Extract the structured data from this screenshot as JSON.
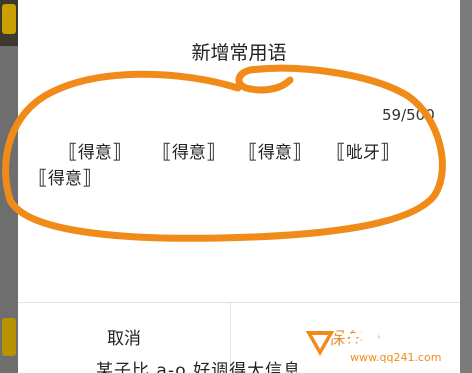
{
  "dialog": {
    "title": "新增常用语",
    "counter": "59/500",
    "phrases": [
      "得意",
      "得意",
      "得意",
      "呲牙",
      "得意"
    ],
    "cancel_label": "取消",
    "save_label": "保存"
  },
  "background": {
    "bottom_text": "某子比 a-o 好调得大信息"
  },
  "watermark": {
    "title": "全球下载",
    "url": "www.qq241.com"
  },
  "colors": {
    "annotation_stroke": "#f08b1a",
    "save_text": "#e69138",
    "watermark": "#f08b1a"
  }
}
